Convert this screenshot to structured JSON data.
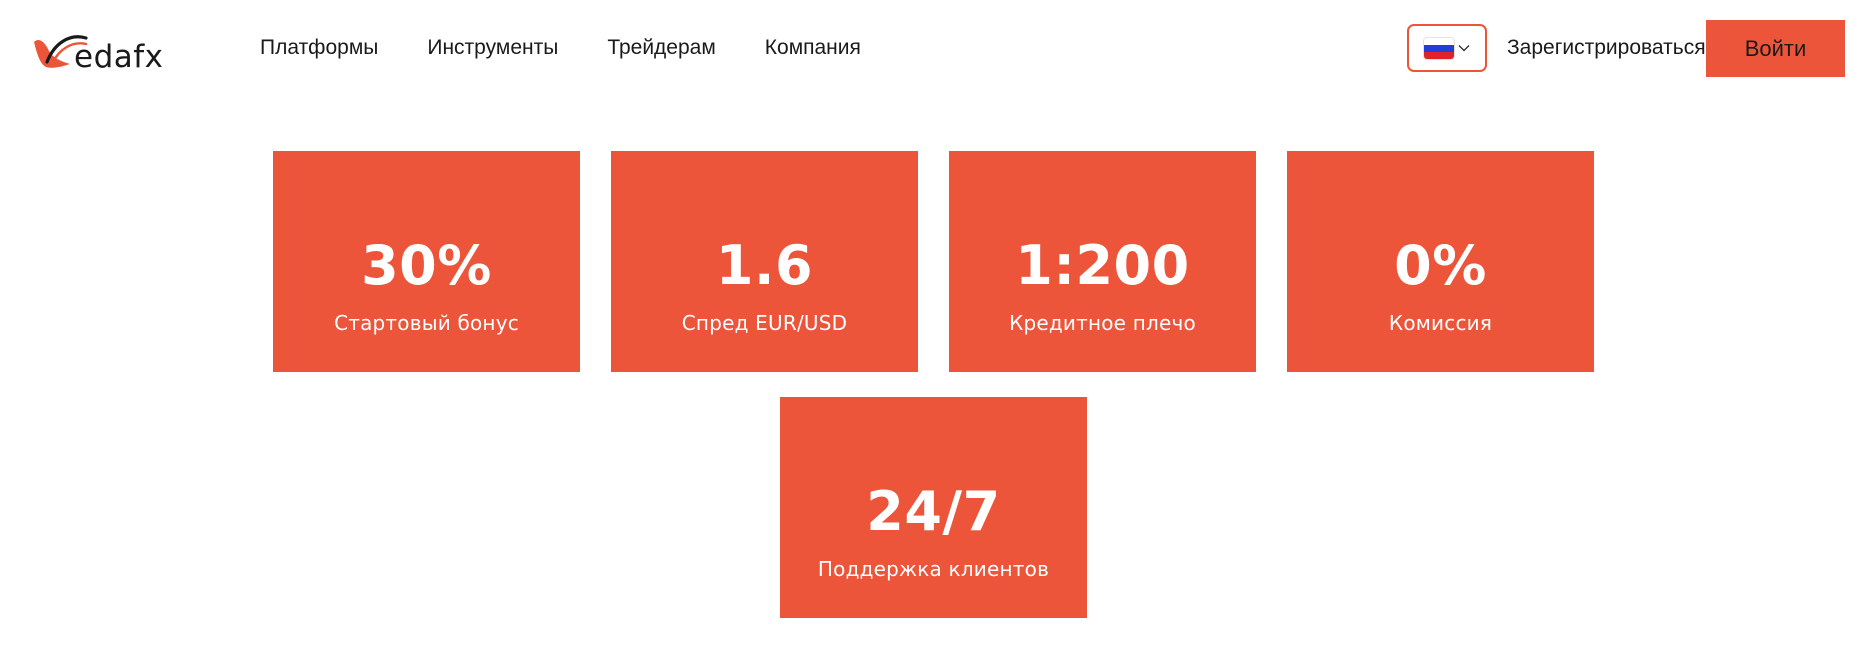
{
  "brand": {
    "name": "edafx",
    "accent_color": "#ec553a"
  },
  "nav": {
    "items": [
      {
        "label": "Платформы"
      },
      {
        "label": "Инструменты"
      },
      {
        "label": "Трейдерам"
      },
      {
        "label": "Компания"
      }
    ]
  },
  "header": {
    "language": {
      "icon": "russia-flag-icon",
      "dropdown_icon": "chevron-down-icon"
    },
    "register_label": "Зарегистрироваться",
    "login_label": "Войти"
  },
  "stats": [
    {
      "value": "30%",
      "label": "Стартовый бонус"
    },
    {
      "value": "1.6",
      "label": "Спред EUR/USD"
    },
    {
      "value": "1:200",
      "label": "Кредитное плечо"
    },
    {
      "value": "0%",
      "label": "Комиссия"
    },
    {
      "value": "24/7",
      "label": "Поддержка клиентов"
    }
  ]
}
